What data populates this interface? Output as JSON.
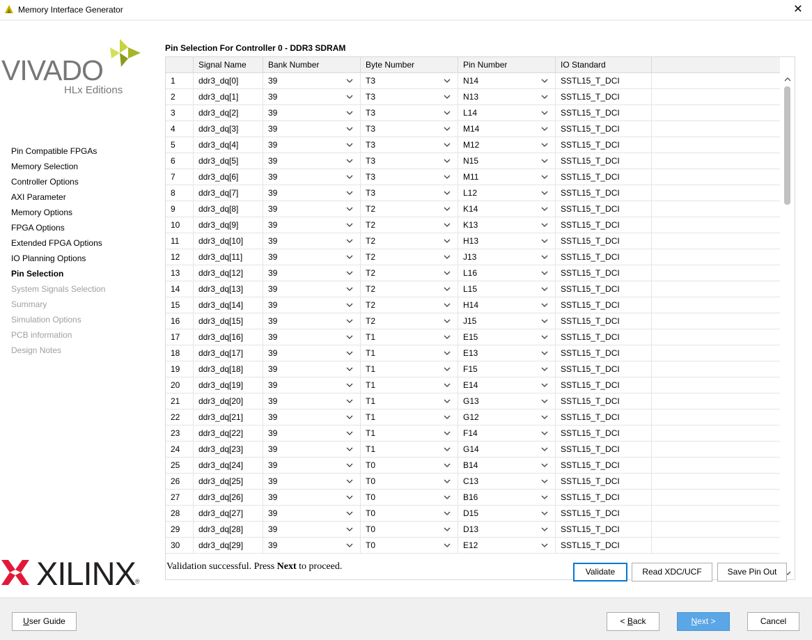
{
  "window": {
    "title": "Memory Interface Generator",
    "close_glyph": "✕"
  },
  "branding": {
    "vivado": "VIVADO",
    "vivado_sub": "HLx Editions",
    "xilinx": "XILINX",
    "xilinx_reg": "®"
  },
  "sidebar": {
    "items": [
      {
        "label": "Pin Compatible FPGAs",
        "state": "normal"
      },
      {
        "label": "Memory Selection",
        "state": "normal"
      },
      {
        "label": "Controller Options",
        "state": "normal"
      },
      {
        "label": "AXI Parameter",
        "state": "normal"
      },
      {
        "label": "Memory Options",
        "state": "normal"
      },
      {
        "label": "FPGA Options",
        "state": "normal"
      },
      {
        "label": "Extended FPGA Options",
        "state": "normal"
      },
      {
        "label": "IO Planning Options",
        "state": "normal"
      },
      {
        "label": "Pin Selection",
        "state": "active"
      },
      {
        "label": "System Signals Selection",
        "state": "disabled"
      },
      {
        "label": "Summary",
        "state": "disabled"
      },
      {
        "label": "Simulation Options",
        "state": "disabled"
      },
      {
        "label": "PCB information",
        "state": "disabled"
      },
      {
        "label": "Design Notes",
        "state": "disabled"
      }
    ]
  },
  "main": {
    "section_title": "Pin Selection For Controller 0 - DDR3 SDRAM",
    "columns": [
      "",
      "Signal Name",
      "Bank Number",
      "Byte Number",
      "Pin Number",
      "IO Standard"
    ],
    "rows": [
      {
        "n": "1",
        "signal": "ddr3_dq[0]",
        "bank": "39",
        "byte": "T3",
        "pin": "N14",
        "io": "SSTL15_T_DCI"
      },
      {
        "n": "2",
        "signal": "ddr3_dq[1]",
        "bank": "39",
        "byte": "T3",
        "pin": "N13",
        "io": "SSTL15_T_DCI"
      },
      {
        "n": "3",
        "signal": "ddr3_dq[2]",
        "bank": "39",
        "byte": "T3",
        "pin": "L14",
        "io": "SSTL15_T_DCI"
      },
      {
        "n": "4",
        "signal": "ddr3_dq[3]",
        "bank": "39",
        "byte": "T3",
        "pin": "M14",
        "io": "SSTL15_T_DCI"
      },
      {
        "n": "5",
        "signal": "ddr3_dq[4]",
        "bank": "39",
        "byte": "T3",
        "pin": "M12",
        "io": "SSTL15_T_DCI"
      },
      {
        "n": "6",
        "signal": "ddr3_dq[5]",
        "bank": "39",
        "byte": "T3",
        "pin": "N15",
        "io": "SSTL15_T_DCI"
      },
      {
        "n": "7",
        "signal": "ddr3_dq[6]",
        "bank": "39",
        "byte": "T3",
        "pin": "M11",
        "io": "SSTL15_T_DCI"
      },
      {
        "n": "8",
        "signal": "ddr3_dq[7]",
        "bank": "39",
        "byte": "T3",
        "pin": "L12",
        "io": "SSTL15_T_DCI"
      },
      {
        "n": "9",
        "signal": "ddr3_dq[8]",
        "bank": "39",
        "byte": "T2",
        "pin": "K14",
        "io": "SSTL15_T_DCI"
      },
      {
        "n": "10",
        "signal": "ddr3_dq[9]",
        "bank": "39",
        "byte": "T2",
        "pin": "K13",
        "io": "SSTL15_T_DCI"
      },
      {
        "n": "11",
        "signal": "ddr3_dq[10]",
        "bank": "39",
        "byte": "T2",
        "pin": "H13",
        "io": "SSTL15_T_DCI"
      },
      {
        "n": "12",
        "signal": "ddr3_dq[11]",
        "bank": "39",
        "byte": "T2",
        "pin": "J13",
        "io": "SSTL15_T_DCI"
      },
      {
        "n": "13",
        "signal": "ddr3_dq[12]",
        "bank": "39",
        "byte": "T2",
        "pin": "L16",
        "io": "SSTL15_T_DCI"
      },
      {
        "n": "14",
        "signal": "ddr3_dq[13]",
        "bank": "39",
        "byte": "T2",
        "pin": "L15",
        "io": "SSTL15_T_DCI"
      },
      {
        "n": "15",
        "signal": "ddr3_dq[14]",
        "bank": "39",
        "byte": "T2",
        "pin": "H14",
        "io": "SSTL15_T_DCI"
      },
      {
        "n": "16",
        "signal": "ddr3_dq[15]",
        "bank": "39",
        "byte": "T2",
        "pin": "J15",
        "io": "SSTL15_T_DCI"
      },
      {
        "n": "17",
        "signal": "ddr3_dq[16]",
        "bank": "39",
        "byte": "T1",
        "pin": "E15",
        "io": "SSTL15_T_DCI"
      },
      {
        "n": "18",
        "signal": "ddr3_dq[17]",
        "bank": "39",
        "byte": "T1",
        "pin": "E13",
        "io": "SSTL15_T_DCI"
      },
      {
        "n": "19",
        "signal": "ddr3_dq[18]",
        "bank": "39",
        "byte": "T1",
        "pin": "F15",
        "io": "SSTL15_T_DCI"
      },
      {
        "n": "20",
        "signal": "ddr3_dq[19]",
        "bank": "39",
        "byte": "T1",
        "pin": "E14",
        "io": "SSTL15_T_DCI"
      },
      {
        "n": "21",
        "signal": "ddr3_dq[20]",
        "bank": "39",
        "byte": "T1",
        "pin": "G13",
        "io": "SSTL15_T_DCI"
      },
      {
        "n": "22",
        "signal": "ddr3_dq[21]",
        "bank": "39",
        "byte": "T1",
        "pin": "G12",
        "io": "SSTL15_T_DCI"
      },
      {
        "n": "23",
        "signal": "ddr3_dq[22]",
        "bank": "39",
        "byte": "T1",
        "pin": "F14",
        "io": "SSTL15_T_DCI"
      },
      {
        "n": "24",
        "signal": "ddr3_dq[23]",
        "bank": "39",
        "byte": "T1",
        "pin": "G14",
        "io": "SSTL15_T_DCI"
      },
      {
        "n": "25",
        "signal": "ddr3_dq[24]",
        "bank": "39",
        "byte": "T0",
        "pin": "B14",
        "io": "SSTL15_T_DCI"
      },
      {
        "n": "26",
        "signal": "ddr3_dq[25]",
        "bank": "39",
        "byte": "T0",
        "pin": "C13",
        "io": "SSTL15_T_DCI"
      },
      {
        "n": "27",
        "signal": "ddr3_dq[26]",
        "bank": "39",
        "byte": "T0",
        "pin": "B16",
        "io": "SSTL15_T_DCI"
      },
      {
        "n": "28",
        "signal": "ddr3_dq[27]",
        "bank": "39",
        "byte": "T0",
        "pin": "D15",
        "io": "SSTL15_T_DCI"
      },
      {
        "n": "29",
        "signal": "ddr3_dq[28]",
        "bank": "39",
        "byte": "T0",
        "pin": "D13",
        "io": "SSTL15_T_DCI"
      },
      {
        "n": "30",
        "signal": "ddr3_dq[29]",
        "bank": "39",
        "byte": "T0",
        "pin": "E12",
        "io": "SSTL15_T_DCI"
      }
    ],
    "validation_pre": "Validation successful. Press ",
    "validation_bold": "Next",
    "validation_post": " to proceed.",
    "buttons": {
      "validate": "Validate",
      "read_xdc": "Read XDC/UCF",
      "save_pin_out": "Save Pin Out"
    }
  },
  "footer": {
    "user_guide_u": "U",
    "user_guide_rest": "ser Guide",
    "back_pre": "< ",
    "back_u": "B",
    "back_rest": "ack",
    "next_u": "N",
    "next_rest": "ext >",
    "cancel": "Cancel"
  },
  "colors": {
    "accent": "#0078d7",
    "primary_button": "#5aa6e6",
    "disabled_text": "#a0a0a0",
    "vivado_leaf": "#c8d23c"
  }
}
